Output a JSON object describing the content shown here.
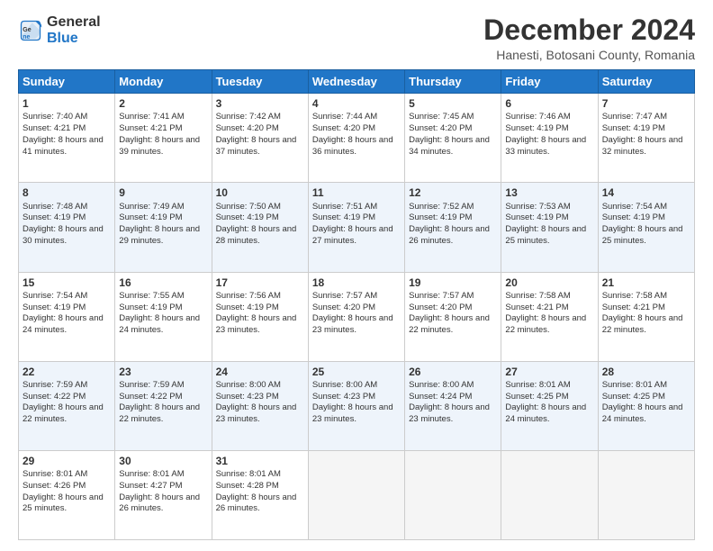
{
  "logo": {
    "line1": "General",
    "line2": "Blue"
  },
  "title": "December 2024",
  "subtitle": "Hanesti, Botosani County, Romania",
  "days_header": [
    "Sunday",
    "Monday",
    "Tuesday",
    "Wednesday",
    "Thursday",
    "Friday",
    "Saturday"
  ],
  "weeks": [
    [
      {
        "num": "1",
        "sunrise": "Sunrise: 7:40 AM",
        "sunset": "Sunset: 4:21 PM",
        "daylight": "Daylight: 8 hours and 41 minutes."
      },
      {
        "num": "2",
        "sunrise": "Sunrise: 7:41 AM",
        "sunset": "Sunset: 4:21 PM",
        "daylight": "Daylight: 8 hours and 39 minutes."
      },
      {
        "num": "3",
        "sunrise": "Sunrise: 7:42 AM",
        "sunset": "Sunset: 4:20 PM",
        "daylight": "Daylight: 8 hours and 37 minutes."
      },
      {
        "num": "4",
        "sunrise": "Sunrise: 7:44 AM",
        "sunset": "Sunset: 4:20 PM",
        "daylight": "Daylight: 8 hours and 36 minutes."
      },
      {
        "num": "5",
        "sunrise": "Sunrise: 7:45 AM",
        "sunset": "Sunset: 4:20 PM",
        "daylight": "Daylight: 8 hours and 34 minutes."
      },
      {
        "num": "6",
        "sunrise": "Sunrise: 7:46 AM",
        "sunset": "Sunset: 4:19 PM",
        "daylight": "Daylight: 8 hours and 33 minutes."
      },
      {
        "num": "7",
        "sunrise": "Sunrise: 7:47 AM",
        "sunset": "Sunset: 4:19 PM",
        "daylight": "Daylight: 8 hours and 32 minutes."
      }
    ],
    [
      {
        "num": "8",
        "sunrise": "Sunrise: 7:48 AM",
        "sunset": "Sunset: 4:19 PM",
        "daylight": "Daylight: 8 hours and 30 minutes."
      },
      {
        "num": "9",
        "sunrise": "Sunrise: 7:49 AM",
        "sunset": "Sunset: 4:19 PM",
        "daylight": "Daylight: 8 hours and 29 minutes."
      },
      {
        "num": "10",
        "sunrise": "Sunrise: 7:50 AM",
        "sunset": "Sunset: 4:19 PM",
        "daylight": "Daylight: 8 hours and 28 minutes."
      },
      {
        "num": "11",
        "sunrise": "Sunrise: 7:51 AM",
        "sunset": "Sunset: 4:19 PM",
        "daylight": "Daylight: 8 hours and 27 minutes."
      },
      {
        "num": "12",
        "sunrise": "Sunrise: 7:52 AM",
        "sunset": "Sunset: 4:19 PM",
        "daylight": "Daylight: 8 hours and 26 minutes."
      },
      {
        "num": "13",
        "sunrise": "Sunrise: 7:53 AM",
        "sunset": "Sunset: 4:19 PM",
        "daylight": "Daylight: 8 hours and 25 minutes."
      },
      {
        "num": "14",
        "sunrise": "Sunrise: 7:54 AM",
        "sunset": "Sunset: 4:19 PM",
        "daylight": "Daylight: 8 hours and 25 minutes."
      }
    ],
    [
      {
        "num": "15",
        "sunrise": "Sunrise: 7:54 AM",
        "sunset": "Sunset: 4:19 PM",
        "daylight": "Daylight: 8 hours and 24 minutes."
      },
      {
        "num": "16",
        "sunrise": "Sunrise: 7:55 AM",
        "sunset": "Sunset: 4:19 PM",
        "daylight": "Daylight: 8 hours and 24 minutes."
      },
      {
        "num": "17",
        "sunrise": "Sunrise: 7:56 AM",
        "sunset": "Sunset: 4:19 PM",
        "daylight": "Daylight: 8 hours and 23 minutes."
      },
      {
        "num": "18",
        "sunrise": "Sunrise: 7:57 AM",
        "sunset": "Sunset: 4:20 PM",
        "daylight": "Daylight: 8 hours and 23 minutes."
      },
      {
        "num": "19",
        "sunrise": "Sunrise: 7:57 AM",
        "sunset": "Sunset: 4:20 PM",
        "daylight": "Daylight: 8 hours and 22 minutes."
      },
      {
        "num": "20",
        "sunrise": "Sunrise: 7:58 AM",
        "sunset": "Sunset: 4:21 PM",
        "daylight": "Daylight: 8 hours and 22 minutes."
      },
      {
        "num": "21",
        "sunrise": "Sunrise: 7:58 AM",
        "sunset": "Sunset: 4:21 PM",
        "daylight": "Daylight: 8 hours and 22 minutes."
      }
    ],
    [
      {
        "num": "22",
        "sunrise": "Sunrise: 7:59 AM",
        "sunset": "Sunset: 4:22 PM",
        "daylight": "Daylight: 8 hours and 22 minutes."
      },
      {
        "num": "23",
        "sunrise": "Sunrise: 7:59 AM",
        "sunset": "Sunset: 4:22 PM",
        "daylight": "Daylight: 8 hours and 22 minutes."
      },
      {
        "num": "24",
        "sunrise": "Sunrise: 8:00 AM",
        "sunset": "Sunset: 4:23 PM",
        "daylight": "Daylight: 8 hours and 23 minutes."
      },
      {
        "num": "25",
        "sunrise": "Sunrise: 8:00 AM",
        "sunset": "Sunset: 4:23 PM",
        "daylight": "Daylight: 8 hours and 23 minutes."
      },
      {
        "num": "26",
        "sunrise": "Sunrise: 8:00 AM",
        "sunset": "Sunset: 4:24 PM",
        "daylight": "Daylight: 8 hours and 23 minutes."
      },
      {
        "num": "27",
        "sunrise": "Sunrise: 8:01 AM",
        "sunset": "Sunset: 4:25 PM",
        "daylight": "Daylight: 8 hours and 24 minutes."
      },
      {
        "num": "28",
        "sunrise": "Sunrise: 8:01 AM",
        "sunset": "Sunset: 4:25 PM",
        "daylight": "Daylight: 8 hours and 24 minutes."
      }
    ],
    [
      {
        "num": "29",
        "sunrise": "Sunrise: 8:01 AM",
        "sunset": "Sunset: 4:26 PM",
        "daylight": "Daylight: 8 hours and 25 minutes."
      },
      {
        "num": "30",
        "sunrise": "Sunrise: 8:01 AM",
        "sunset": "Sunset: 4:27 PM",
        "daylight": "Daylight: 8 hours and 26 minutes."
      },
      {
        "num": "31",
        "sunrise": "Sunrise: 8:01 AM",
        "sunset": "Sunset: 4:28 PM",
        "daylight": "Daylight: 8 hours and 26 minutes."
      },
      null,
      null,
      null,
      null
    ]
  ]
}
